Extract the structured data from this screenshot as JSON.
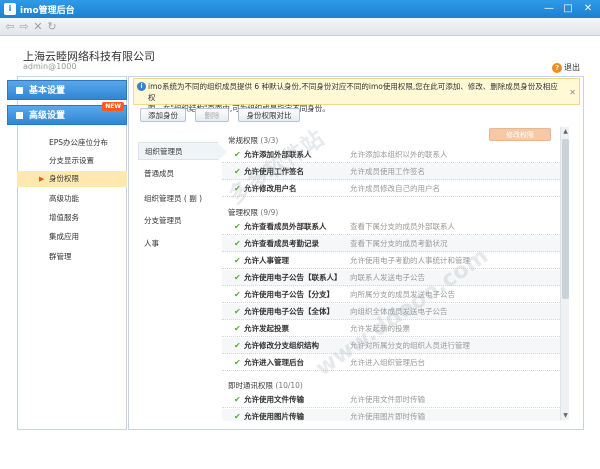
{
  "window": {
    "title": "imo管理后台",
    "app_icon": "i",
    "minimize": "—",
    "maximize": "□",
    "close": "✕"
  },
  "nav": {
    "back": "⇦",
    "forward": "⇨",
    "stop": "✕",
    "refresh": "↻"
  },
  "header": {
    "company": "上海云睦网络科技有限公司",
    "user": "admin@1000",
    "logout": "退出"
  },
  "leftmenu": {
    "basic": "基本设置",
    "advanced": "高级设置",
    "new_badge": "NEW",
    "items": [
      {
        "label": "EPS办公座位分布"
      },
      {
        "label": "分支显示设置"
      },
      {
        "label": "身份权限"
      },
      {
        "label": "高级功能"
      },
      {
        "label": "增值服务"
      },
      {
        "label": "集成应用"
      },
      {
        "label": "群管理"
      }
    ]
  },
  "notice": {
    "line1": "imo系统为不同的组织成员提供 6 种默认身份,不同身份对应不同的imo使用权限,您在此可添加、修改、删除成员身份及相应权",
    "line2": "限。在\"组织结构\"页面中,可为组织成员指定不同身份。"
  },
  "toolbar": {
    "add": "添加身份",
    "delete": "删除",
    "compare": "身份权限对比",
    "modify": "修改权限"
  },
  "roles": [
    "组织管理员",
    "普通成员",
    "组织管理员 ( 副 )",
    "分支管理员",
    "人事"
  ],
  "groups": [
    {
      "title": "常规权限",
      "count": "(3/3)",
      "perms": [
        {
          "name": "允许添加外部联系人",
          "desc": "允许添加本组织以外的联系人"
        },
        {
          "name": "允许使用工作签名",
          "desc": "允许成员使用工作签名"
        },
        {
          "name": "允许修改用户名",
          "desc": "允许成员修改自己的用户名"
        }
      ]
    },
    {
      "title": "管理权限",
      "count": "(9/9)",
      "perms": [
        {
          "name": "允许查看成员外部联系人",
          "desc": "查看下属分支的成员外部联系人"
        },
        {
          "name": "允许查看成员考勤记录",
          "desc": "查看下属分支的成员考勤状况"
        },
        {
          "name": "允许人事管理",
          "desc": "允许使用电子考勤的人事统计和管理"
        },
        {
          "name": "允许使用电子公告【联系人】",
          "desc": "向联系人发送电子公告"
        },
        {
          "name": "允许使用电子公告【分支】",
          "desc": "向所属分支的成员发送电子公告"
        },
        {
          "name": "允许使用电子公告【全体】",
          "desc": "向组织全体成员发送电子公告"
        },
        {
          "name": "允许发起投票",
          "desc": "允许发起新的投票"
        },
        {
          "name": "允许修改分支组织结构",
          "desc": "允许对所属分支的组织人员进行管理"
        },
        {
          "name": "允许进入管理后台",
          "desc": "允许进入组织管理后台"
        }
      ]
    },
    {
      "title": "即时通讯权限",
      "count": "(10/10)",
      "perms": [
        {
          "name": "允许使用文件传输",
          "desc": "允许使用文件即时传输"
        },
        {
          "name": "允许使用图片传输",
          "desc": "允许使用图片即时传输"
        }
      ]
    }
  ],
  "watermarks": [
    "多多软件站",
    "www.ddooo.com"
  ]
}
